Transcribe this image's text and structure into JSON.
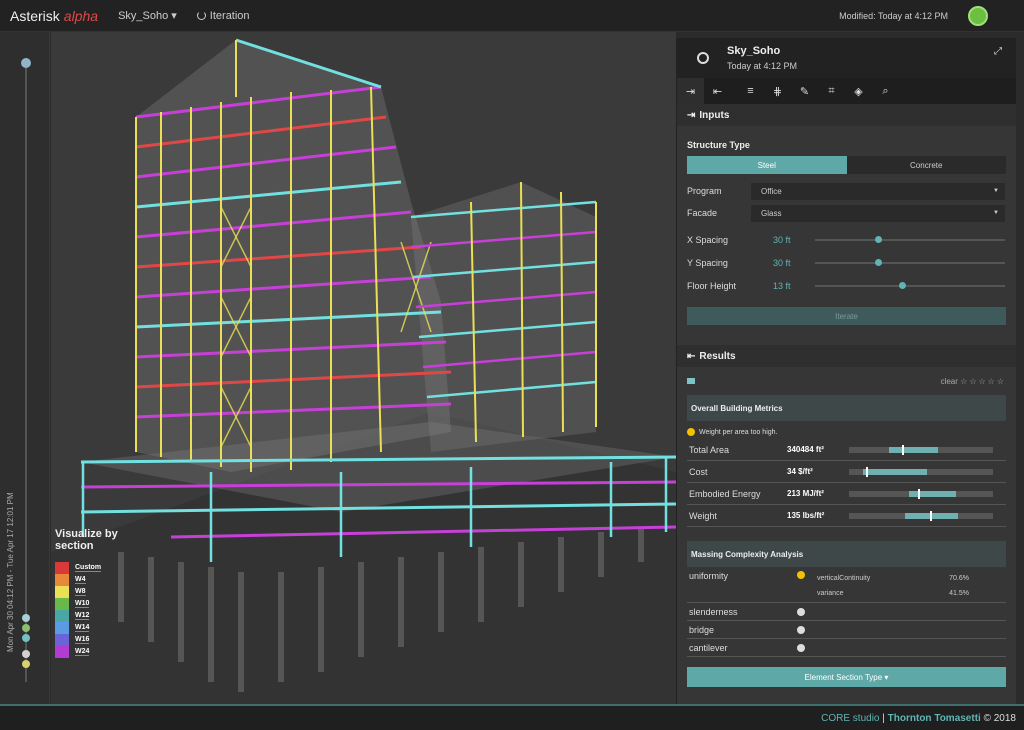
{
  "topbar": {
    "brand": "Asterisk",
    "brand_tag": "alpha",
    "project_menu": "Sky_Soho ▾",
    "iteration_label": "Iteration",
    "modified": "Modified: Today at 4:12 PM"
  },
  "timeline": {
    "range_label": "Mon Apr 30 04:12 PM - Tue Apr 17 12:01 PM"
  },
  "legend": {
    "title": "Visualize by section",
    "items": [
      {
        "label": "Custom",
        "color": "#d83a3a"
      },
      {
        "label": "W4",
        "color": "#e8893a"
      },
      {
        "label": "W8",
        "color": "#eadf55"
      },
      {
        "label": "W10",
        "color": "#68b84a"
      },
      {
        "label": "W12",
        "color": "#4ba7a5"
      },
      {
        "label": "W14",
        "color": "#5b9be3"
      },
      {
        "label": "W16",
        "color": "#6b64d8"
      },
      {
        "label": "W24",
        "color": "#b23bd1"
      }
    ]
  },
  "panel": {
    "title": "Sky_Soho",
    "subtitle": "Today at 4:12 PM",
    "inputs_header": "Inputs",
    "structure_type_label": "Structure Type",
    "structure_options": [
      "Steel",
      "Concrete"
    ],
    "structure_selected": "Steel",
    "program_label": "Program",
    "program_value": "Office",
    "facade_label": "Facade",
    "facade_value": "Glass",
    "sliders": [
      {
        "label": "X Spacing",
        "value": "30 ft",
        "position": 0.33
      },
      {
        "label": "Y Spacing",
        "value": "30 ft",
        "position": 0.33
      },
      {
        "label": "Floor Height",
        "value": "13 ft",
        "position": 0.46
      }
    ],
    "iterate_label": "Iterate",
    "results_header": "Results",
    "clear_label": "clear",
    "stars": "☆☆☆☆☆",
    "metrics_header": "Overall Building Metrics",
    "warning": "Weight per area too high.",
    "metrics": [
      {
        "label": "Total Area",
        "value": "340484 ft²",
        "range_start": 0.28,
        "range_end": 0.62,
        "marker": 0.37
      },
      {
        "label": "Cost",
        "value": "34 $/ft²",
        "range_start": 0.1,
        "range_end": 0.54,
        "marker": 0.12
      },
      {
        "label": "Embodied Energy",
        "value": "213 MJ/ft²",
        "range_start": 0.42,
        "range_end": 0.74,
        "marker": 0.48
      },
      {
        "label": "Weight",
        "value": "135 lbs/ft²",
        "range_start": 0.39,
        "range_end": 0.76,
        "marker": 0.56
      }
    ],
    "complexity_header": "Massing Complexity Analysis",
    "complexity": [
      {
        "label": "uniformity",
        "status": "warning",
        "details": [
          {
            "name": "verticalContinuity",
            "value": "70.6%"
          },
          {
            "name": "variance",
            "value": "41.5%"
          }
        ]
      },
      {
        "label": "slenderness",
        "status": "ok"
      },
      {
        "label": "bridge",
        "status": "ok"
      },
      {
        "label": "cantilever",
        "status": "ok"
      }
    ],
    "section_button": "Element Section Type ▾"
  },
  "footer": {
    "core": "CORE studio",
    "separator": "|",
    "company": "Thornton Tomasetti",
    "copyright": "© 2018"
  },
  "colors": {
    "accent": "#5fa8a8",
    "warning": "#f2c200"
  }
}
